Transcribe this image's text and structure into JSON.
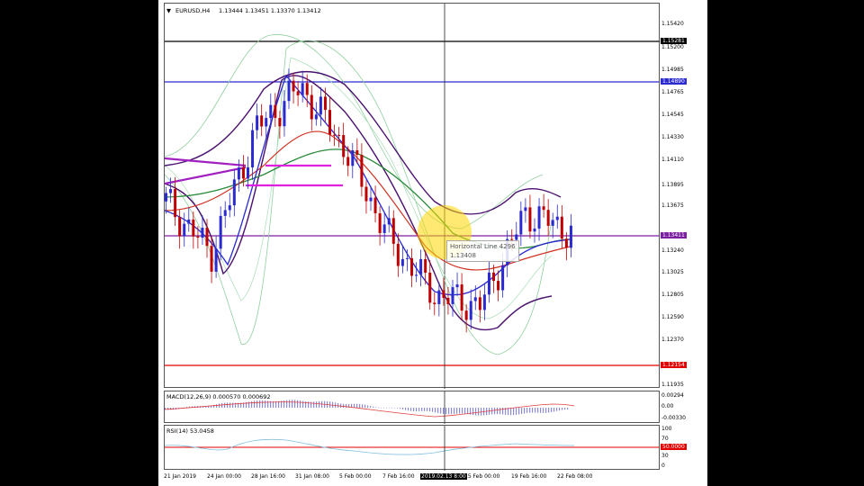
{
  "chart": {
    "symbol_label": "EURUSD,H4",
    "ohlc": "1.13444 1.13451 1.13370 1.13412",
    "indicators": {
      "macd_label": "MACD(12,26,9) 0.000570 0.000692",
      "rsi_label": "RSI(14) 53.0458"
    },
    "price_ticks": [
      "1.15420",
      "1.15200",
      "1.14985",
      "1.14765",
      "1.14545",
      "1.14330",
      "1.14110",
      "1.13895",
      "1.13675",
      "1.13240",
      "1.13025",
      "1.12805",
      "1.12590",
      "1.12370",
      "1.11935"
    ],
    "price_tags": {
      "black_line": "1.15281",
      "blue_line": "1.14890",
      "purple_line": "1.13411",
      "red_line": "1.12154"
    },
    "macd_ticks": [
      "0.00294",
      "0.00",
      "-0.00330"
    ],
    "rsi_ticks": [
      "100",
      "70",
      "50.0000",
      "30",
      "0"
    ],
    "time_labels": [
      "21 Jan 2019",
      "24 Jan 00:00",
      "28 Jan 16:00",
      "31 Jan 08:00",
      "5 Feb 00:00",
      "7 Feb 16:00",
      "2019.02.13 8:00",
      "15 Feb 00:00",
      "19 Feb 16:00",
      "22 Feb 08:00"
    ],
    "tooltip": {
      "name": "Horizontal Line 4296",
      "value": "1.13408"
    },
    "colors": {
      "black_line": "#000000",
      "blue_line": "#2a2ad0",
      "purple_line": "#7a1fa0",
      "red_line": "#e00000",
      "bull_candle": "#2a2ad0",
      "bear_candle": "#c00000",
      "magenta_segment": "#e020e0"
    }
  },
  "chart_data": {
    "type": "line",
    "title": "EURUSD,H4",
    "x": [
      "21 Jan",
      "24 Jan",
      "28 Jan",
      "31 Jan",
      "5 Feb",
      "7 Feb",
      "13 Feb",
      "15 Feb",
      "19 Feb",
      "22 Feb"
    ],
    "series": [
      {
        "values": [
          1.137,
          1.132,
          1.144,
          1.148,
          1.142,
          1.133,
          1.128,
          1.127,
          1.136,
          1.1341
        ]
      }
    ],
    "ylim": [
      1.119,
      1.156
    ]
  }
}
